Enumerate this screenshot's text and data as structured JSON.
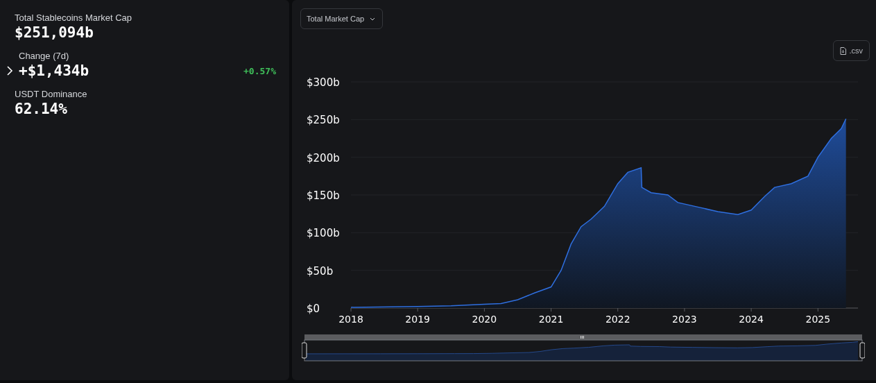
{
  "stats": [
    {
      "label": "Total Stablecoins Market Cap",
      "value": "$251,094b"
    },
    {
      "label": "Change (7d)",
      "value": "+$1,434b",
      "change": "+0.57%",
      "expanded": false
    },
    {
      "label": "USDT Dominance",
      "value": "62.14%"
    }
  ],
  "chart_panel": {
    "metric_select": {
      "value": "Total Market Cap"
    },
    "csv_button": ".csv",
    "chart_data": {
      "type": "area",
      "x": [
        2018.0,
        2019.0,
        2019.5,
        2020.0,
        2020.25,
        2020.5,
        2020.75,
        2021.0,
        2021.15,
        2021.3,
        2021.45,
        2021.6,
        2021.8,
        2022.0,
        2022.15,
        2022.35,
        2022.36,
        2022.5,
        2022.75,
        2022.9,
        2023.2,
        2023.5,
        2023.8,
        2024.0,
        2024.2,
        2024.35,
        2024.6,
        2024.85,
        2025.0,
        2025.2,
        2025.35,
        2025.42
      ],
      "grid": true,
      "series": [
        {
          "color": "#2f6fe0",
          "values": [
            1,
            2,
            3,
            5,
            6,
            11,
            20,
            28,
            50,
            85,
            108,
            118,
            135,
            165,
            180,
            186,
            160,
            153,
            150,
            140,
            134,
            128,
            124,
            130,
            148,
            160,
            165,
            175,
            200,
            225,
            238,
            251
          ]
        }
      ],
      "xlim": [
        2018,
        2025.6
      ],
      "ylim": [
        0,
        300
      ],
      "xticks": [
        2018,
        2019,
        2020,
        2021,
        2022,
        2023,
        2024,
        2025
      ],
      "yticks": [
        {
          "value": 0,
          "label": "$0"
        },
        {
          "value": 50,
          "label": "$50b"
        },
        {
          "value": 100,
          "label": "$100b"
        },
        {
          "value": 150,
          "label": "$150b"
        },
        {
          "value": 200,
          "label": "$200b"
        },
        {
          "value": 250,
          "label": "$250b"
        },
        {
          "value": 300,
          "label": "$300b"
        }
      ]
    },
    "range_slider": {
      "level": 1
    }
  }
}
